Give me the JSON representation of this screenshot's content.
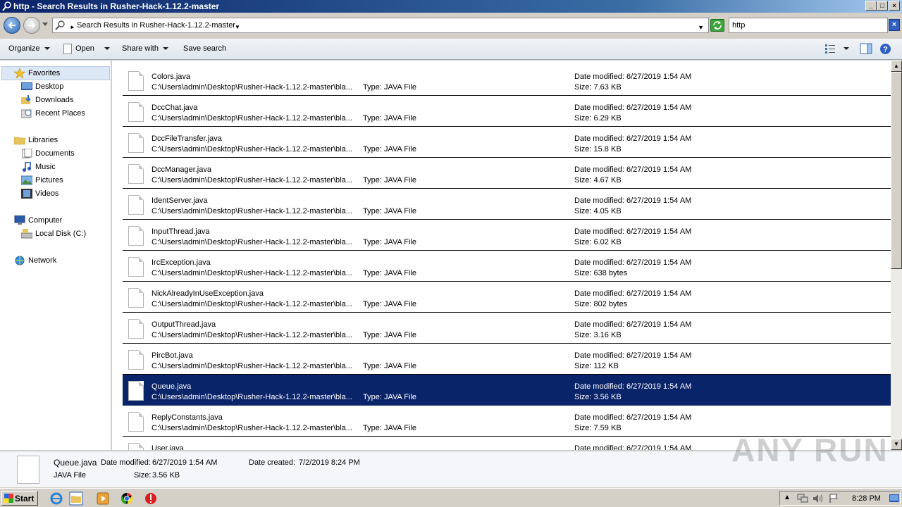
{
  "window": {
    "title": "http - Search Results in Rusher-Hack-1.12.2-master",
    "controls": [
      "_",
      "□",
      "×"
    ]
  },
  "address": {
    "path": "Search Results in Rusher-Hack-1.12.2-master",
    "search_value": "http"
  },
  "toolbar": {
    "organize": "Organize",
    "open": "Open",
    "share": "Share with",
    "save_search": "Save search"
  },
  "nav": {
    "favorites": "Favorites",
    "desktop": "Desktop",
    "downloads": "Downloads",
    "recent": "Recent Places",
    "libraries": "Libraries",
    "documents": "Documents",
    "music": "Music",
    "pictures": "Pictures",
    "videos": "Videos",
    "computer": "Computer",
    "local_disk": "Local Disk (C:)",
    "network": "Network"
  },
  "results": [
    {
      "name": "Colors.java",
      "path": "C:\\Users\\admin\\Desktop\\Rusher-Hack-1.12.2-master\\bla...",
      "type": "Type: JAVA File",
      "date": "Date modified: 6/27/2019 1:54 AM",
      "size": "Size: 7.63 KB"
    },
    {
      "name": "DccChat.java",
      "path": "C:\\Users\\admin\\Desktop\\Rusher-Hack-1.12.2-master\\bla...",
      "type": "Type: JAVA File",
      "date": "Date modified: 6/27/2019 1:54 AM",
      "size": "Size: 6.29 KB"
    },
    {
      "name": "DccFileTransfer.java",
      "path": "C:\\Users\\admin\\Desktop\\Rusher-Hack-1.12.2-master\\bla...",
      "type": "Type: JAVA File",
      "date": "Date modified: 6/27/2019 1:54 AM",
      "size": "Size: 15.8 KB"
    },
    {
      "name": "DccManager.java",
      "path": "C:\\Users\\admin\\Desktop\\Rusher-Hack-1.12.2-master\\bla...",
      "type": "Type: JAVA File",
      "date": "Date modified: 6/27/2019 1:54 AM",
      "size": "Size: 4.67 KB"
    },
    {
      "name": "IdentServer.java",
      "path": "C:\\Users\\admin\\Desktop\\Rusher-Hack-1.12.2-master\\bla...",
      "type": "Type: JAVA File",
      "date": "Date modified: 6/27/2019 1:54 AM",
      "size": "Size: 4.05 KB"
    },
    {
      "name": "InputThread.java",
      "path": "C:\\Users\\admin\\Desktop\\Rusher-Hack-1.12.2-master\\bla...",
      "type": "Type: JAVA File",
      "date": "Date modified: 6/27/2019 1:54 AM",
      "size": "Size: 6.02 KB"
    },
    {
      "name": "IrcException.java",
      "path": "C:\\Users\\admin\\Desktop\\Rusher-Hack-1.12.2-master\\bla...",
      "type": "Type: JAVA File",
      "date": "Date modified: 6/27/2019 1:54 AM",
      "size": "Size: 638 bytes"
    },
    {
      "name": "NickAlreadyInUseException.java",
      "path": "C:\\Users\\admin\\Desktop\\Rusher-Hack-1.12.2-master\\bla...",
      "type": "Type: JAVA File",
      "date": "Date modified: 6/27/2019 1:54 AM",
      "size": "Size: 802 bytes"
    },
    {
      "name": "OutputThread.java",
      "path": "C:\\Users\\admin\\Desktop\\Rusher-Hack-1.12.2-master\\bla...",
      "type": "Type: JAVA File",
      "date": "Date modified: 6/27/2019 1:54 AM",
      "size": "Size: 3.16 KB"
    },
    {
      "name": "PircBot.java",
      "path": "C:\\Users\\admin\\Desktop\\Rusher-Hack-1.12.2-master\\bla...",
      "type": "Type: JAVA File",
      "date": "Date modified: 6/27/2019 1:54 AM",
      "size": "Size: 112 KB"
    },
    {
      "name": "Queue.java",
      "path": "C:\\Users\\admin\\Desktop\\Rusher-Hack-1.12.2-master\\bla...",
      "type": "Type: JAVA File",
      "date": "Date modified: 6/27/2019 1:54 AM",
      "size": "Size: 3.56 KB",
      "selected": true
    },
    {
      "name": "ReplyConstants.java",
      "path": "C:\\Users\\admin\\Desktop\\Rusher-Hack-1.12.2-master\\bla...",
      "type": "Type: JAVA File",
      "date": "Date modified: 6/27/2019 1:54 AM",
      "size": "Size: 7.59 KB"
    },
    {
      "name": "User.java",
      "path": "",
      "type": "",
      "date": "Date modified: 6/27/2019 1:54 AM",
      "size": ""
    }
  ],
  "details": {
    "name": "Queue.java",
    "modified_label": "Date modified:",
    "modified_value": "6/27/2019 1:54 AM",
    "created_label": "Date created:",
    "created_value": "7/2/2019 8:24 PM",
    "type": "JAVA File",
    "size_label": "Size:",
    "size_value": "3.56 KB"
  },
  "watermark": "ANY RUN",
  "taskbar": {
    "start": "Start",
    "clock": "8:28 PM"
  },
  "colors": {
    "selection": "#0a246a",
    "titlebar": "#0a246a",
    "chrome": "#d4d0c8"
  }
}
